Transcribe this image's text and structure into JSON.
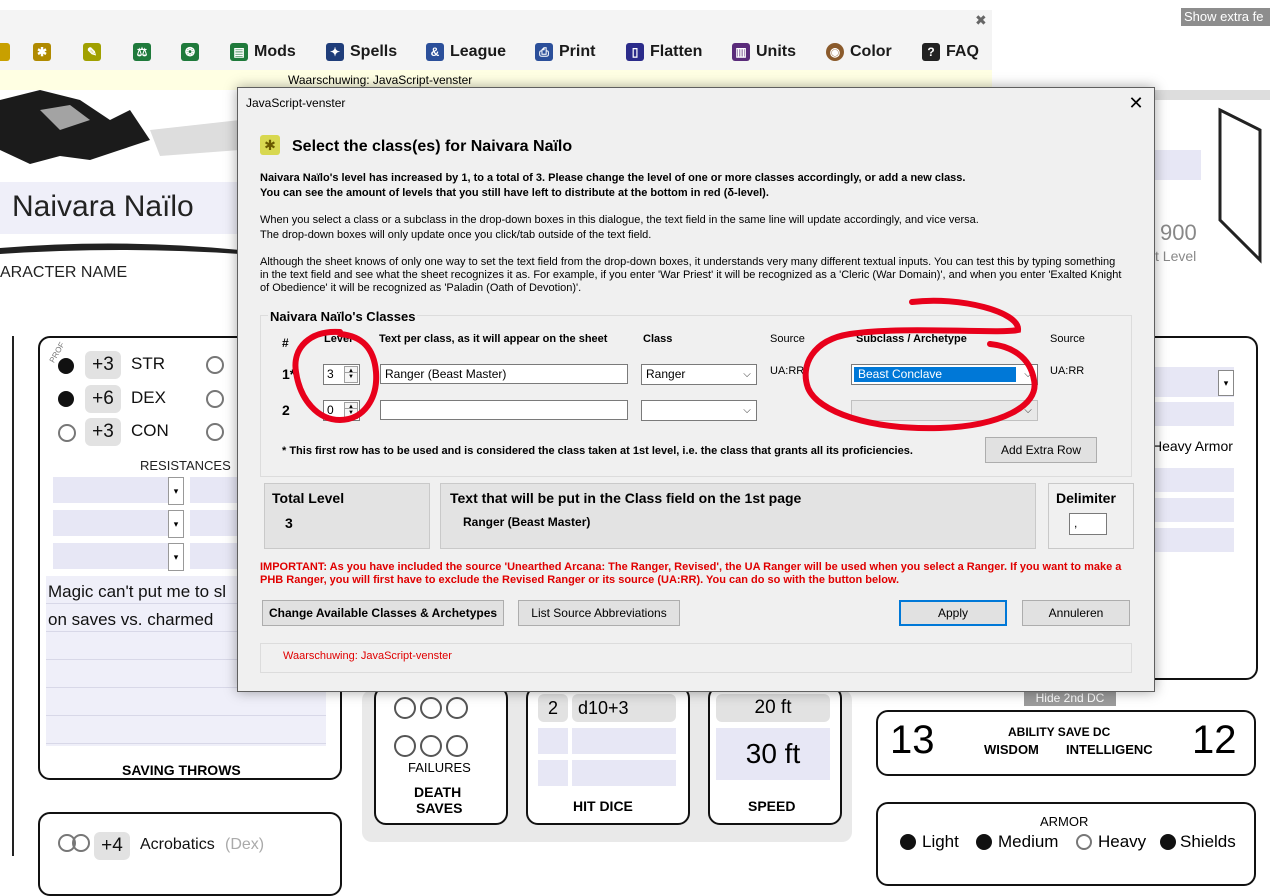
{
  "topright_button": "Show extra fe",
  "toolbar": {
    "items": [
      {
        "label": "Mods",
        "icon": "mods-icon",
        "color": "#1f7a3b"
      },
      {
        "label": "Spells",
        "icon": "spells-icon",
        "color": "#1f3d7a"
      },
      {
        "label": "League",
        "icon": "league-icon",
        "color": "#2b4f9a"
      },
      {
        "label": "Print",
        "icon": "print-icon",
        "color": "#2b4f9a"
      },
      {
        "label": "Flatten",
        "icon": "flatten-icon",
        "color": "#2b2b8a"
      },
      {
        "label": "Units",
        "icon": "units-icon",
        "color": "#5a2b7a"
      },
      {
        "label": "Color",
        "icon": "color-icon",
        "color": "#8a5a2b"
      },
      {
        "label": "FAQ",
        "icon": "faq-icon",
        "color": "#222222"
      }
    ],
    "warning": "Waarschuwing: JavaScript-venster",
    "close": "✖"
  },
  "sheet": {
    "character_name": "Naivara Naïlo",
    "character_name_label": "ARACTER NAME",
    "xp_value": "900",
    "xp_label": "t Level",
    "abilities": [
      {
        "mod": "+3",
        "name": "STR"
      },
      {
        "mod": "+6",
        "name": "DEX"
      },
      {
        "mod": "+3",
        "name": "CON"
      }
    ],
    "resistances_label": "RESISTANCES",
    "notes_line1": "Magic can't put me to sl",
    "notes_line2": "on saves vs. charmed",
    "saving_throws_label": "SAVING THROWS",
    "skill_mod": "+4",
    "skill_name": "Acrobatics",
    "skill_ability": "(Dex)",
    "prof_label": "PROF",
    "failures_label": "FAILURES",
    "death_saves_label1": "DEATH",
    "death_saves_label2": "SAVES",
    "hit_dice_count": "2",
    "hit_dice_value": "d10+3",
    "hit_dice_label": "HIT DICE",
    "speed_small": "20 ft",
    "speed_big": "30 ft",
    "speed_label": "SPEED",
    "hide_2nd_dc": "Hide 2nd DC",
    "dc_left": "13",
    "dc_right": "12",
    "ability_save_dc_label": "ABILITY SAVE DC",
    "dc_ability1": "WISDOM",
    "dc_ability2": "INTELLIGENC",
    "heavy_armor": "Heavy Armor",
    "armor_label": "ARMOR",
    "armor_options": [
      "Light",
      "Medium",
      "Heavy",
      "Shields"
    ]
  },
  "dialog": {
    "window_title": "JavaScript-venster",
    "heading": "Select the class(es) for Naivara Naïlo",
    "intro_bold_1": "Naivara Naïlo's level has increased by 1, to a total of 3. Please change the level of one or more classes accordingly, or add a new class.",
    "intro_bold_2": "You can see the amount of levels that you still have left to distribute at the bottom in red (δ-level).",
    "para2_1": "When you select a class or a subclass in the drop-down boxes in this dialogue, the text field in the same line will update accordingly, and vice versa.",
    "para2_2": "The drop-down boxes will only update once you click/tab outside of the text field.",
    "para3": "Although the sheet knows of only one way to set the text field from the drop-down boxes, it understands very many different textual inputs. You can test this by typing something in the text field and see what the sheet recognizes it as. For example, if you enter 'War Priest' it will be recognized as a 'Cleric (War Domain)', and when you enter 'Exalted Knight of Obedience' it will be recognized as 'Paladin (Oath of Devotion)'.",
    "classes_group_title": "Naivara Naïlo's Classes",
    "columns": {
      "num": "#",
      "level": "Level",
      "text": "Text per class, as it will appear on the sheet",
      "class": "Class",
      "source": "Source",
      "subclass": "Subclass / Archetype",
      "source2": "Source"
    },
    "rows": [
      {
        "num": "1*",
        "level": "3",
        "text": "Ranger (Beast Master)",
        "class": "Ranger",
        "source": "UA:RR",
        "subclass": "Beast Conclave",
        "source2": "UA:RR"
      },
      {
        "num": "2",
        "level": "0",
        "text": "",
        "class": "",
        "source": "",
        "subclass": "",
        "source2": ""
      }
    ],
    "footnote": "* This first row has to be used and is considered the class taken at 1st level, i.e. the class that grants all its proficiencies.",
    "add_row_button": "Add Extra Row",
    "total_level_label": "Total Level",
    "total_level_value": "3",
    "class_field_label": "Text that will be put in the Class field on the 1st page",
    "class_field_value": "Ranger (Beast Master)",
    "delimiter_label": "Delimiter",
    "delimiter_value": ",",
    "important": "IMPORTANT: As you have included the source 'Unearthed Arcana: The Ranger, Revised', the UA Ranger will be used when you select a Ranger. If you want to make a PHB Ranger, you will first have to exclude the Revised Ranger or its source (UA:RR). You can do so with the button below.",
    "change_button": "Change Available Classes & Archetypes",
    "list_source_button": "List Source Abbreviations",
    "apply_button": "Apply",
    "cancel_button": "Annuleren",
    "footer_warning": "Waarschuwing: JavaScript-venster",
    "colors": {
      "important_red": "#e00000",
      "annotation_red": "#e8001b",
      "highlight_blue": "#0078d7"
    }
  }
}
